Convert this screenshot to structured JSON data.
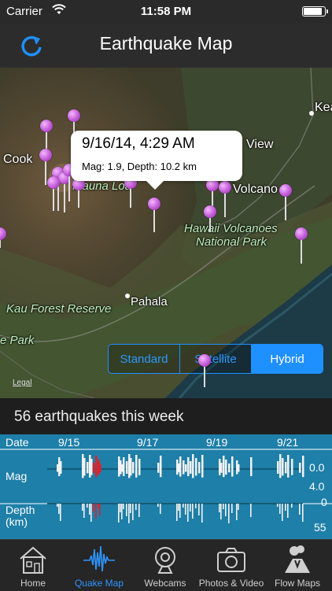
{
  "status": {
    "carrier": "Carrier",
    "time": "11:58 PM",
    "battery_level": 0.92
  },
  "nav": {
    "title": "Earthquake Map"
  },
  "map": {
    "labels": {
      "cook": "Cook",
      "mauna_loa": "Mauna Loa",
      "view": "View",
      "volcano": "Volcano",
      "kea": "Kea",
      "hvnp1": "Hawaii Volcanoes",
      "hvnp2": "National Park",
      "kau": "Kau Forest Reserve",
      "pahala": "Pahala",
      "park": "e Park"
    },
    "callout": {
      "title": "9/16/14, 4:29 AM",
      "subtitle": "Mag: 1.9, Depth: 10.2 km"
    },
    "map_types": [
      "Standard",
      "Satellite",
      "Hybrid"
    ],
    "selected_map_type": "Hybrid",
    "legal": "Legal"
  },
  "summary": {
    "count_text": "56 earthquakes this week"
  },
  "timeline": {
    "date_label": "Date",
    "mag_label": "Mag",
    "depth_label": "Depth",
    "depth_unit": "(km)",
    "dates": [
      "9/15",
      "9/17",
      "9/19",
      "9/21"
    ],
    "mag_min": "0.0",
    "mag_max": "4.0",
    "depth_min": "0",
    "depth_max": "55"
  },
  "tabs": [
    {
      "label": "Home",
      "icon": "house-icon"
    },
    {
      "label": "Quake Map",
      "icon": "seismograph-icon"
    },
    {
      "label": "Webcams",
      "icon": "webcam-icon"
    },
    {
      "label": "Photos & Video",
      "icon": "camera-icon"
    },
    {
      "label": "Flow Maps",
      "icon": "volcano-icon"
    }
  ],
  "active_tab": "Quake Map",
  "colors": {
    "accent": "#1e90ff",
    "pin": "#c35ad8",
    "timeline_bg": "#1e7fa8",
    "highlight": "#e0202a"
  }
}
